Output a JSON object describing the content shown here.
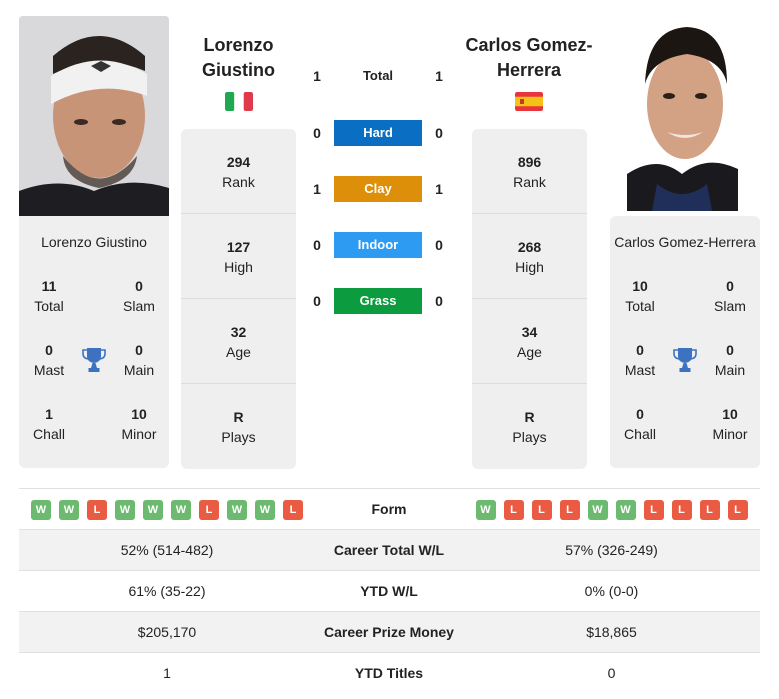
{
  "player_left": {
    "name_header_line1": "Lorenzo",
    "name_header_line2": "Giustino",
    "full_name": "Lorenzo Giustino",
    "flag": "italy-flag",
    "photo": "player-photo",
    "titles": {
      "total": {
        "value": "11",
        "label": "Total"
      },
      "slam": {
        "value": "0",
        "label": "Slam"
      },
      "mast": {
        "value": "0",
        "label": "Mast"
      },
      "main": {
        "value": "0",
        "label": "Main"
      },
      "chall": {
        "value": "1",
        "label": "Chall"
      },
      "minor": {
        "value": "10",
        "label": "Minor"
      }
    },
    "stats": [
      {
        "value": "294",
        "label": "Rank"
      },
      {
        "value": "127",
        "label": "High"
      },
      {
        "value": "32",
        "label": "Age"
      },
      {
        "value": "R",
        "label": "Plays"
      }
    ],
    "form": [
      "W",
      "W",
      "L",
      "W",
      "W",
      "W",
      "L",
      "W",
      "W",
      "L"
    ]
  },
  "player_right": {
    "name_header_line1": "Carlos Gomez-",
    "name_header_line2": "Herrera",
    "full_name": "Carlos Gomez-Herrera",
    "flag": "spain-flag",
    "photo": "player-photo",
    "titles": {
      "total": {
        "value": "10",
        "label": "Total"
      },
      "slam": {
        "value": "0",
        "label": "Slam"
      },
      "mast": {
        "value": "0",
        "label": "Mast"
      },
      "main": {
        "value": "0",
        "label": "Main"
      },
      "chall": {
        "value": "0",
        "label": "Chall"
      },
      "minor": {
        "value": "10",
        "label": "Minor"
      }
    },
    "stats": [
      {
        "value": "896",
        "label": "Rank"
      },
      {
        "value": "268",
        "label": "High"
      },
      {
        "value": "34",
        "label": "Age"
      },
      {
        "value": "R",
        "label": "Plays"
      }
    ],
    "form": [
      "W",
      "L",
      "L",
      "L",
      "W",
      "W",
      "L",
      "L",
      "L",
      "L"
    ]
  },
  "h2h": [
    {
      "label": "Total",
      "left": "1",
      "right": "1",
      "color": ""
    },
    {
      "label": "Hard",
      "left": "0",
      "right": "0",
      "color": "#0a6ec2"
    },
    {
      "label": "Clay",
      "left": "1",
      "right": "1",
      "color": "#dd8f0a"
    },
    {
      "label": "Indoor",
      "left": "0",
      "right": "0",
      "color": "#2d9bf2"
    },
    {
      "label": "Grass",
      "left": "0",
      "right": "0",
      "color": "#0c9b3f"
    }
  ],
  "comparison": {
    "form_label": "Form",
    "rows": [
      {
        "label": "Career Total W/L",
        "left": "52% (514-482)",
        "right": "57% (326-249)"
      },
      {
        "label": "YTD W/L",
        "left": "61% (35-22)",
        "right": "0% (0-0)"
      },
      {
        "label": "Career Prize Money",
        "left": "$205,170",
        "right": "$18,865"
      },
      {
        "label": "YTD Titles",
        "left": "1",
        "right": "0"
      }
    ]
  },
  "colors": {
    "win": "#6cba6f",
    "loss": "#ea5b44",
    "trophy": "#3d72c0",
    "card_bg": "#efefef"
  }
}
